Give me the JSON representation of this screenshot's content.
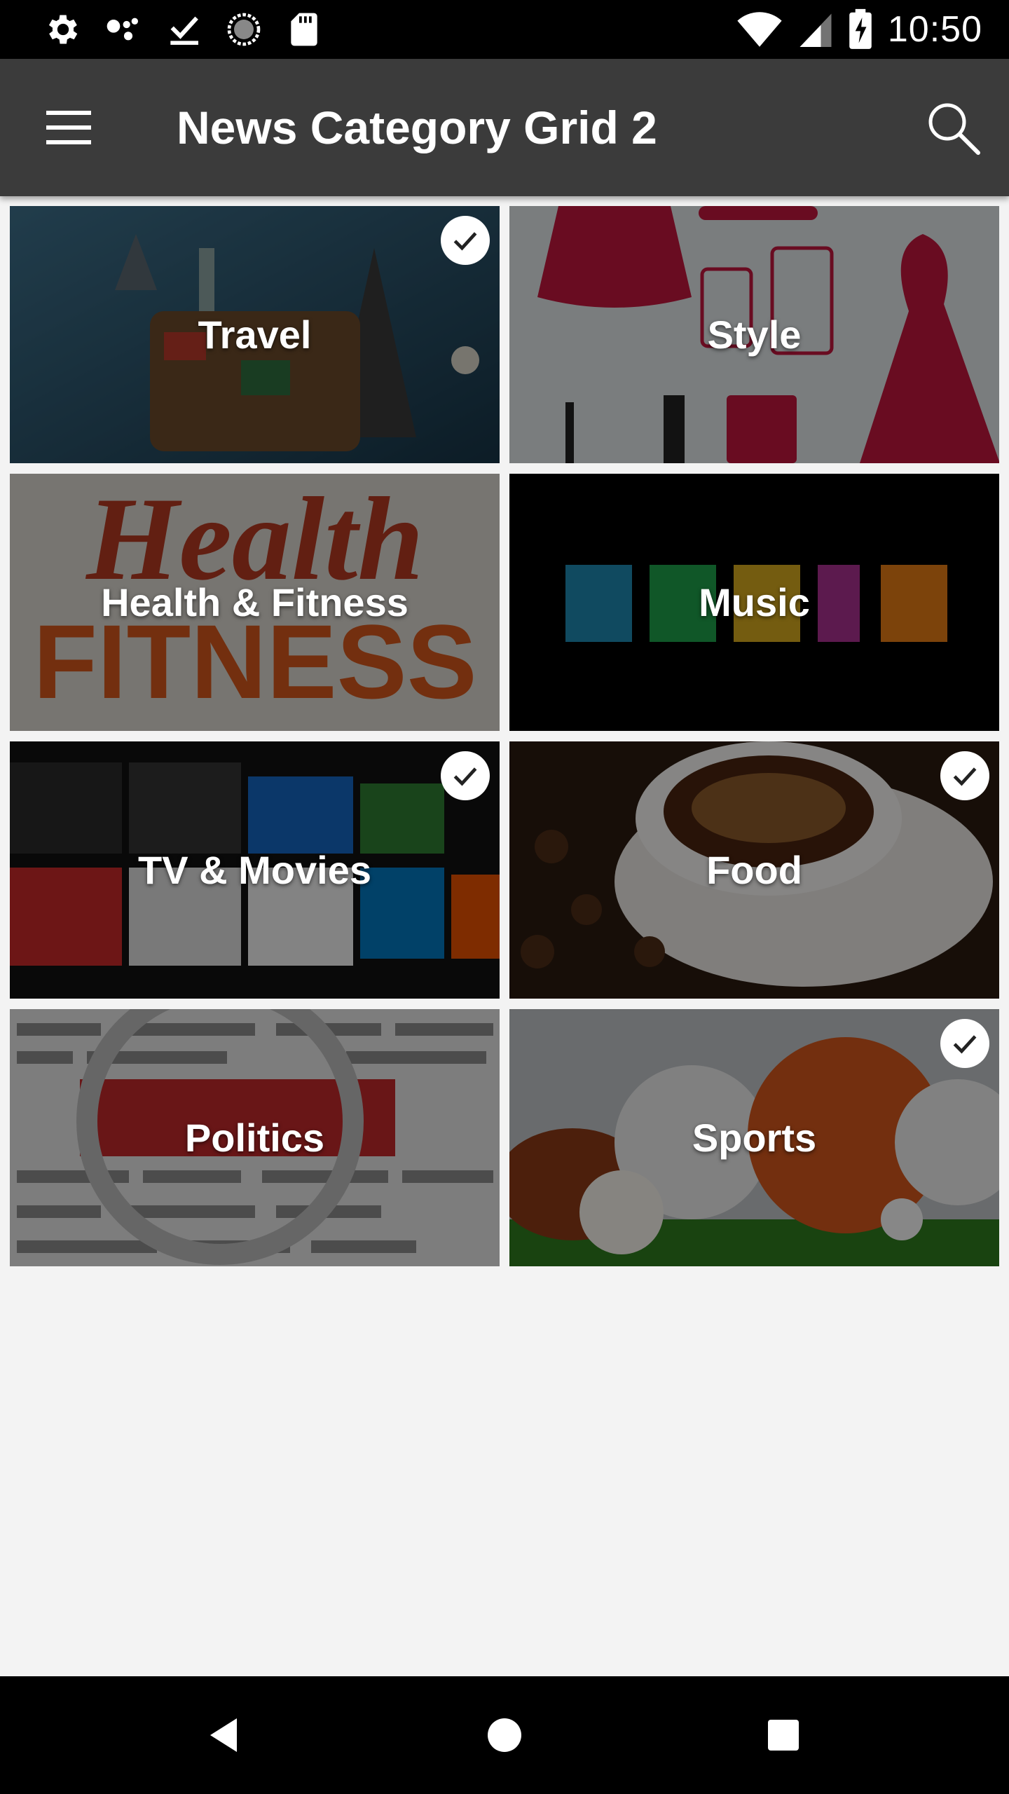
{
  "status_bar": {
    "time": "10:50",
    "left_icons": [
      "settings-icon",
      "assistant-dots-icon",
      "download-done-icon",
      "sync-circle-icon",
      "sd-card-icon"
    ],
    "right_icons": [
      "wifi-icon",
      "cell-signal-icon",
      "battery-charging-icon"
    ]
  },
  "app_bar": {
    "title": "News Category Grid 2",
    "menu_icon": "hamburger-menu-icon",
    "search_icon": "search-icon"
  },
  "categories": [
    {
      "label": "Travel",
      "selected": true
    },
    {
      "label": "Style",
      "selected": false
    },
    {
      "label": "Health & Fitness",
      "selected": false
    },
    {
      "label": "Music",
      "selected": false
    },
    {
      "label": "TV & Movies",
      "selected": true
    },
    {
      "label": "Food",
      "selected": true
    },
    {
      "label": "Politics",
      "selected": false
    },
    {
      "label": "Sports",
      "selected": true
    }
  ],
  "nav_bar": {
    "buttons": [
      "back-icon",
      "home-icon",
      "recents-icon"
    ]
  },
  "colors": {
    "app_bar": "#3b3b3b",
    "background": "#f3f3f3",
    "status_bar": "#000000"
  }
}
